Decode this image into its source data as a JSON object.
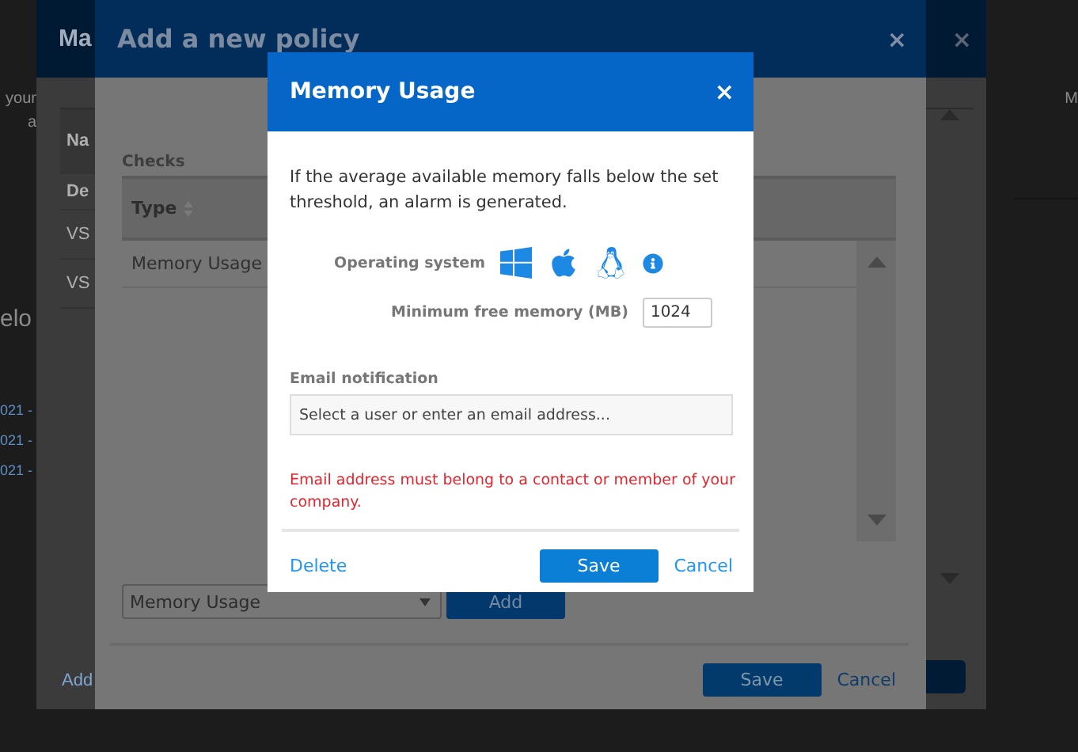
{
  "background_page": {
    "left_fragments": [
      "your",
      "a"
    ],
    "heading_fragment": "elo",
    "date_fragments": [
      "021 -",
      "021 -",
      "021 -"
    ],
    "right_fragment": "M"
  },
  "manage_dialog": {
    "title": "Ma",
    "close": "×",
    "table": {
      "header": "Na",
      "rows": [
        "De",
        "VS",
        "VS"
      ]
    },
    "add_link": "Add"
  },
  "policy_dialog": {
    "title": "Add a new policy",
    "close": "×",
    "checks_label": "Checks",
    "table": {
      "columns": [
        "Type"
      ],
      "rows": [
        "Memory Usage"
      ]
    },
    "check_select": "Memory Usage",
    "add_button": "Add",
    "save_button": "Save",
    "cancel_link": "Cancel"
  },
  "memory_dialog": {
    "title": "Memory Usage",
    "close": "×",
    "description": "If the average available memory falls below the set threshold, an alarm is generated.",
    "os_label": "Operating system",
    "os_options": [
      {
        "kind": "windows"
      },
      {
        "kind": "apple"
      },
      {
        "kind": "linux"
      }
    ],
    "min_memory_label": "Minimum free memory (MB)",
    "min_memory_value": "1024",
    "email_label": "Email notification",
    "email_placeholder": "Select a user or enter an email address...",
    "error": "Email address must belong to a contact or member of your company.",
    "delete_link": "Delete",
    "save_button": "Save",
    "cancel_link": "Cancel"
  }
}
